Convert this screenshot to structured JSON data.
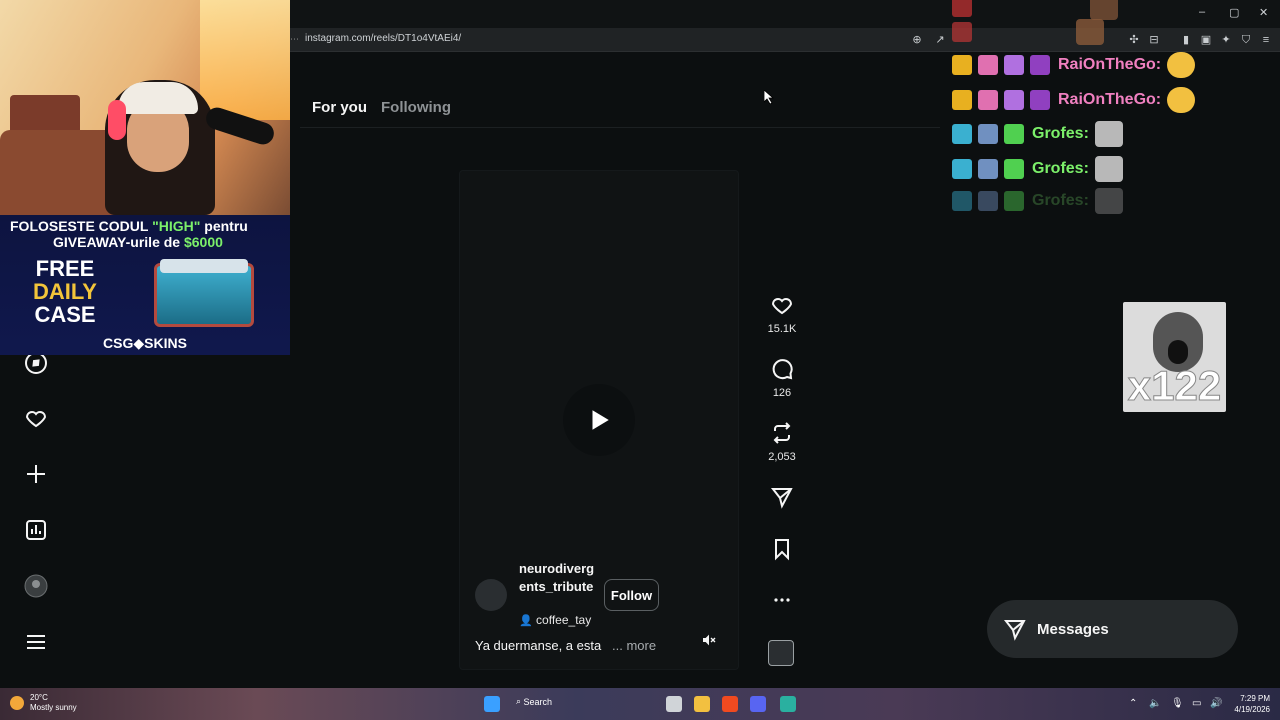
{
  "browser": {
    "url": "instagram.com/reels/DT1o4VtAEi4/",
    "window_controls": [
      "–",
      "▢",
      "✕"
    ]
  },
  "stream_overlay": {
    "promo_line1_prefix": "FOLOSESTE CODUL",
    "promo_code": "\"HIGH\"",
    "promo_line1_suffix": "pentru",
    "promo_line2_prefix": "GIVEAWAY-urile de",
    "promo_amount": "$6000",
    "promo_free": "FREE",
    "promo_daily": "DAILY",
    "promo_case": "CASE",
    "promo_brand": "CSG◆SKINS"
  },
  "tabs": {
    "active": "For you",
    "inactive": "Following"
  },
  "reel": {
    "author": "neurodivergents_tribute",
    "audio": "coffee_tay",
    "follow_label": "Follow",
    "caption": "Ya duermanse, a esta",
    "more_label": "... more"
  },
  "actions": {
    "likes": "15.1K",
    "comments": "126",
    "reposts": "2,053"
  },
  "chat": {
    "lines": [
      {
        "user": "RaiOnTheGo:",
        "color": "#f080c0"
      },
      {
        "user": "RaiOnTheGo:",
        "color": "#f080c0"
      },
      {
        "user": "Grofes:",
        "color": "#7cf06a"
      },
      {
        "user": "Grofes:",
        "color": "#7cf06a"
      },
      {
        "user": "Grofes:",
        "color": "#4a8a45"
      }
    ],
    "alert_text": "x122"
  },
  "messages": {
    "label": "Messages"
  },
  "taskbar": {
    "temperature": "20°C",
    "weather": "Mostly sunny",
    "search_label": "Search",
    "time": "7:29 PM",
    "date": "4/19/2026"
  },
  "colors": {
    "background": "#0c0f10",
    "text": "#f5f5f5",
    "muted": "#8e9295"
  }
}
